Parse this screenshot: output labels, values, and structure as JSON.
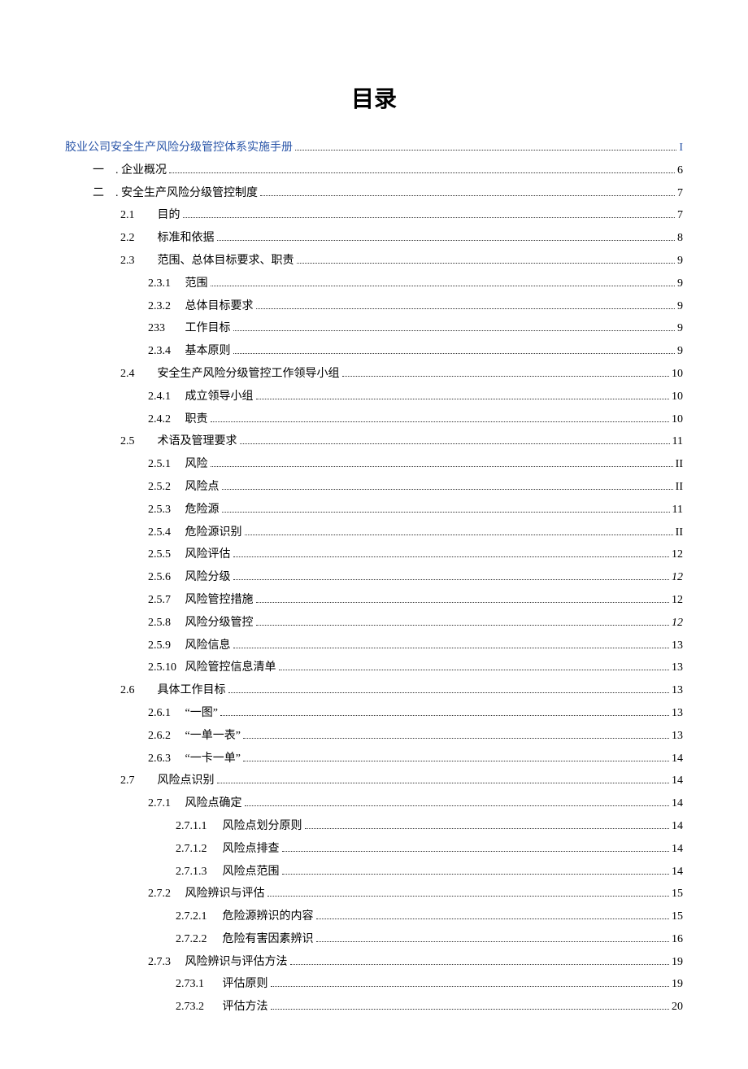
{
  "title": "目录",
  "toc": [
    {
      "indent": 0,
      "label": "胶业公司安全生产风险分级管控体系实施手册",
      "page": "I",
      "linkStyle": true
    },
    {
      "indent": 1,
      "label": "一　. 企业概况",
      "page": "6"
    },
    {
      "indent": 1,
      "label": "二　. 安全生产风险分级管控制度",
      "page": "7"
    },
    {
      "indent": 2,
      "num": "2.1",
      "label": "目的",
      "page": "7"
    },
    {
      "indent": 2,
      "num": "2.2",
      "label": "标准和依据",
      "page": "8"
    },
    {
      "indent": 2,
      "num": "2.3",
      "label": "范围、总体目标要求、职责",
      "page": "9"
    },
    {
      "indent": 3,
      "num": "2.3.1",
      "label": "范围",
      "page": "9"
    },
    {
      "indent": 3,
      "num": "2.3.2",
      "label": "总体目标要求",
      "page": "9"
    },
    {
      "indent": 3,
      "num": "233",
      "label": "工作目标",
      "page": "9"
    },
    {
      "indent": 3,
      "num": "2.3.4",
      "label": "基本原则",
      "page": "9"
    },
    {
      "indent": 2,
      "num": "2.4",
      "label": "安全生产风险分级管控工作领导小组",
      "page": "10"
    },
    {
      "indent": 3,
      "num": "2.4.1",
      "label": "成立领导小组",
      "page": "10"
    },
    {
      "indent": 3,
      "num": "2.4.2",
      "label": "职责",
      "page": "10"
    },
    {
      "indent": 2,
      "num": "2.5",
      "label": "术语及管理要求",
      "page": "11"
    },
    {
      "indent": 3,
      "num": "2.5.1",
      "label": "风险",
      "page": "II"
    },
    {
      "indent": 3,
      "num": "2.5.2",
      "label": "风险点",
      "page": "II"
    },
    {
      "indent": 3,
      "num": "2.5.3",
      "label": "危险源",
      "page": "11"
    },
    {
      "indent": 3,
      "num": "2.5.4",
      "label": "危险源识别",
      "page": "II"
    },
    {
      "indent": 3,
      "num": "2.5.5",
      "label": "风险评估",
      "page": "12"
    },
    {
      "indent": 3,
      "num": "2.5.6",
      "label": "风险分级",
      "page": "12",
      "italic": true
    },
    {
      "indent": 3,
      "num": "2.5.7",
      "label": "风险管控措施",
      "page": "12"
    },
    {
      "indent": 3,
      "num": "2.5.8",
      "label": "风险分级管控",
      "page": "12",
      "italic": true
    },
    {
      "indent": 3,
      "num": "2.5.9",
      "label": "风险信息",
      "page": "13"
    },
    {
      "indent": 3,
      "num": "2.5.10",
      "label": "风险管控信息清单",
      "page": "13"
    },
    {
      "indent": 2,
      "num": "2.6",
      "label": "具体工作目标",
      "page": "13"
    },
    {
      "indent": 3,
      "num": "2.6.1",
      "label": "“一图”",
      "page": "13"
    },
    {
      "indent": 3,
      "num": "2.6.2",
      "label": "“一单一表”",
      "page": "13"
    },
    {
      "indent": 3,
      "num": "2.6.3",
      "label": "“一卡一单”",
      "page": "14"
    },
    {
      "indent": 2,
      "num": "2.7",
      "label": "风险点识别",
      "page": "14"
    },
    {
      "indent": 3,
      "num": "2.7.1",
      "label": "风险点确定",
      "page": "14"
    },
    {
      "indent": 4,
      "num": "2.7.1.1",
      "label": "风险点划分原则",
      "page": "14"
    },
    {
      "indent": 4,
      "num": "2.7.1.2",
      "label": "风险点排查",
      "page": "14"
    },
    {
      "indent": 4,
      "num": "2.7.1.3",
      "label": "风险点范围",
      "page": "14"
    },
    {
      "indent": 3,
      "num": "2.7.2",
      "label": "风险辨识与评估",
      "page": "15"
    },
    {
      "indent": 4,
      "num": "2.7.2.1",
      "label": "危险源辨识的内容",
      "page": "15"
    },
    {
      "indent": 4,
      "num": "2.7.2.2",
      "label": "危险有害因素辨识",
      "page": "16"
    },
    {
      "indent": 3,
      "num": "2.7.3",
      "label": "风险辨识与评估方法",
      "page": "19"
    },
    {
      "indent": 4,
      "num": "2.73.1",
      "label": "评估原则",
      "page": "19"
    },
    {
      "indent": 4,
      "num": "2.73.2",
      "label": "评估方法",
      "page": "20"
    }
  ]
}
